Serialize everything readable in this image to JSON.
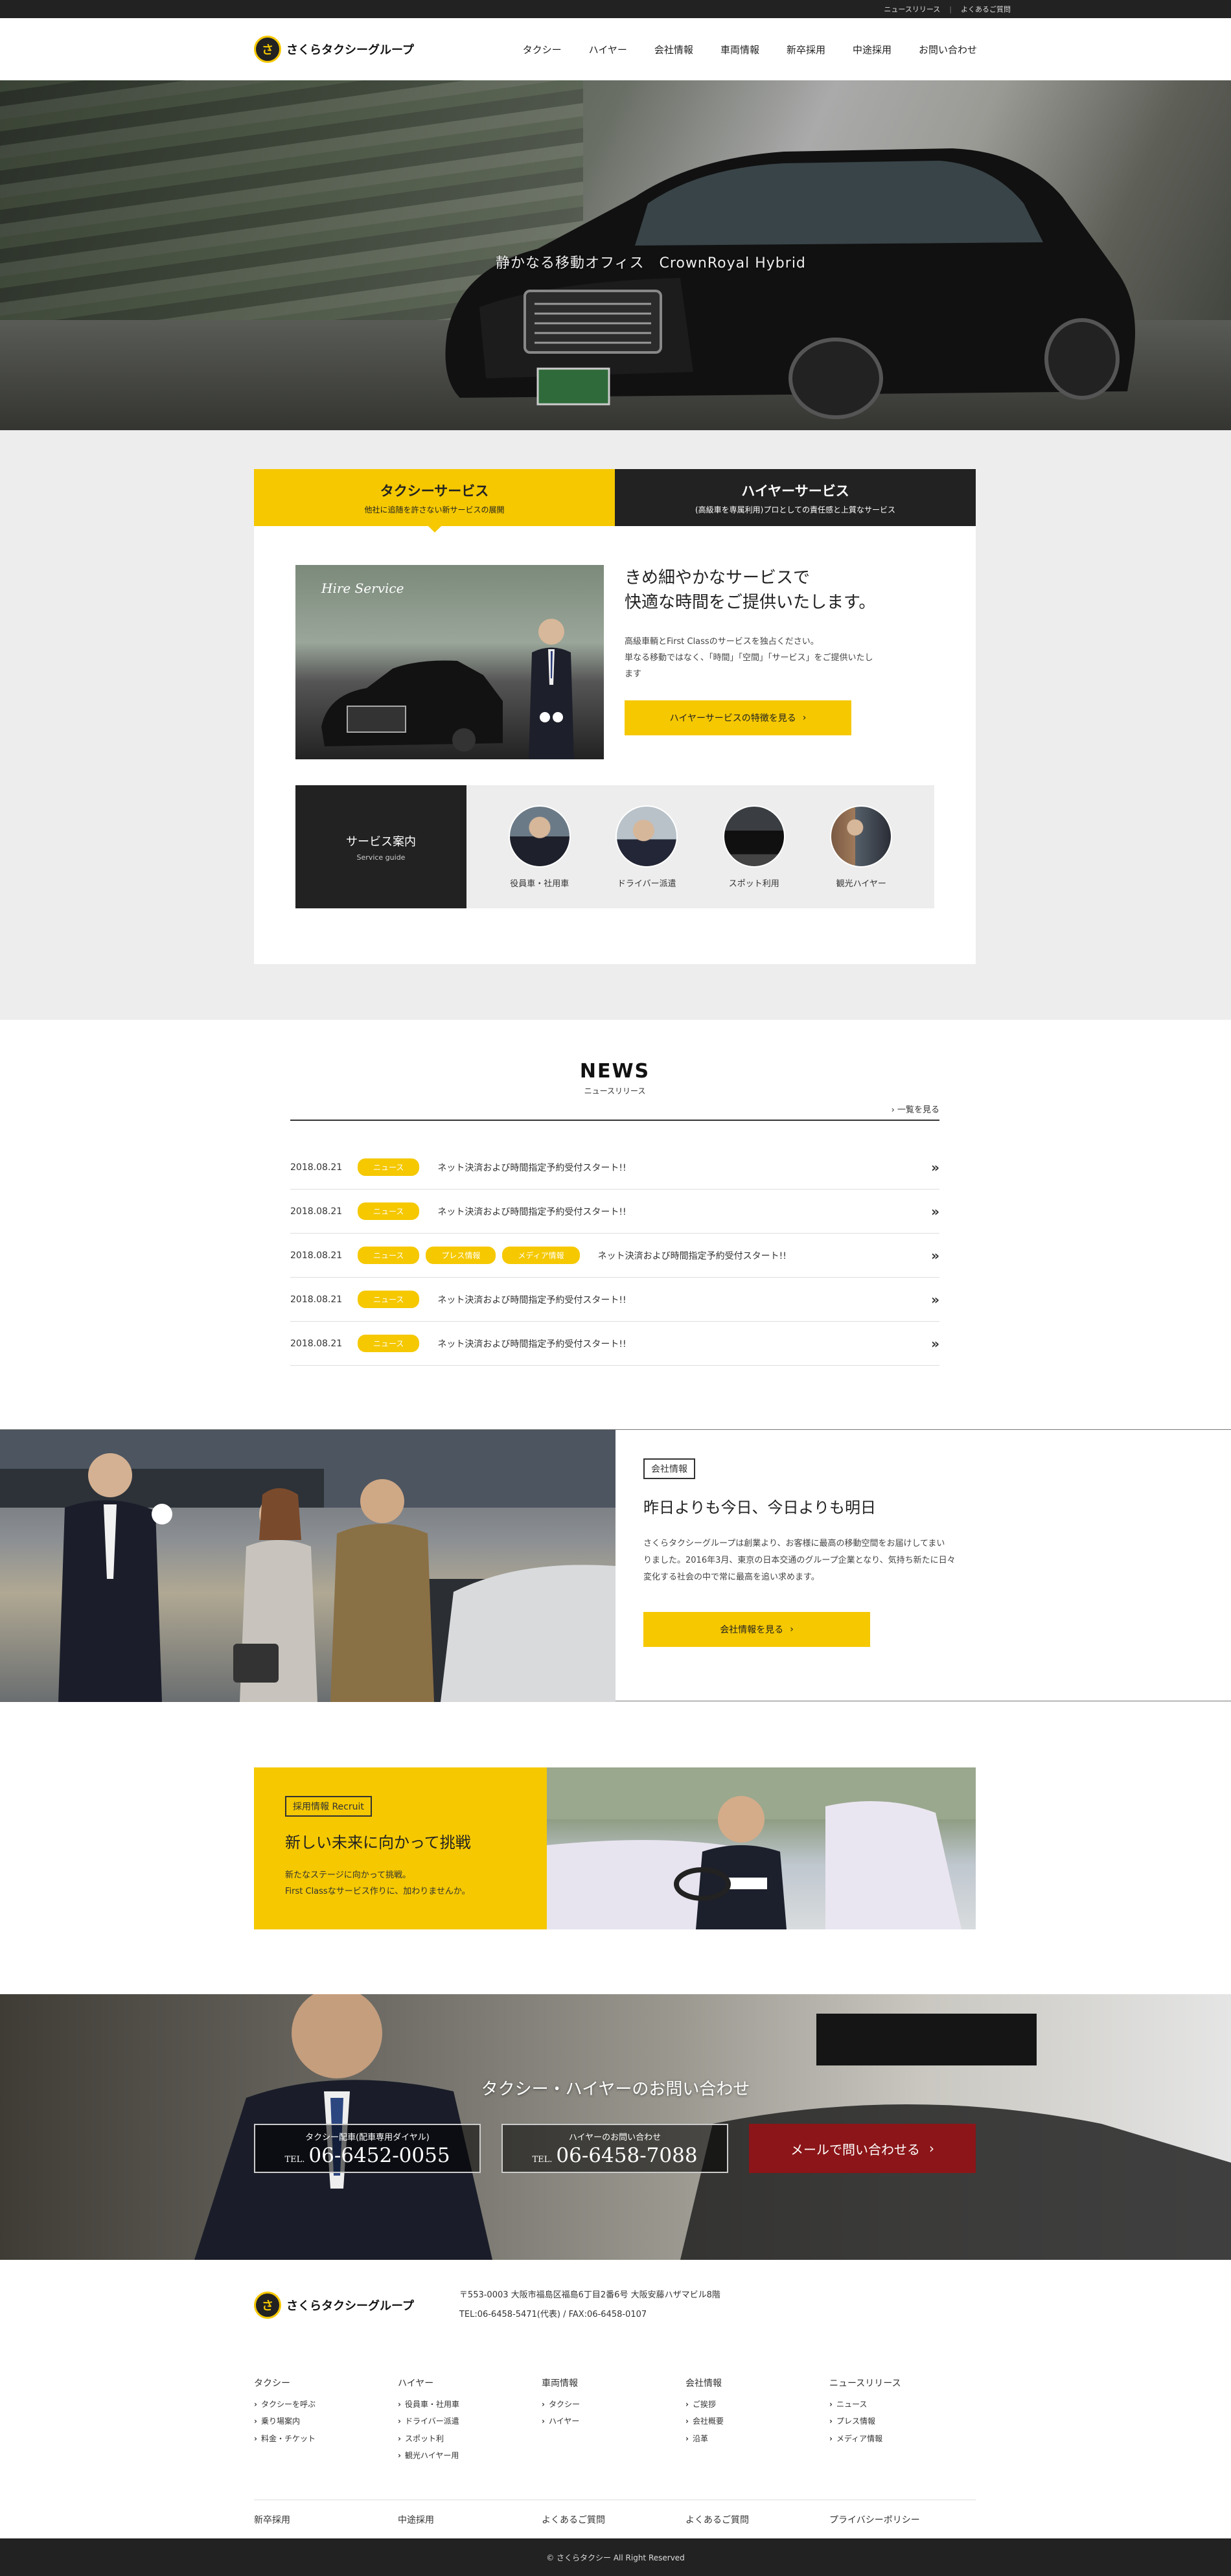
{
  "topbar": {
    "links": [
      "ニュースリリース",
      "よくあるご質問"
    ]
  },
  "header": {
    "logo_text": "さくらタクシーグループ",
    "nav": [
      "タクシー",
      "ハイヤー",
      "会社情報",
      "車両情報",
      "新卒採用",
      "中途採用",
      "お問い合わせ"
    ]
  },
  "hero": {
    "caption": "静かなる移動オフィス　CrownRoyal Hybrid"
  },
  "service": {
    "tabs": [
      {
        "title": "タクシーサービス",
        "sub": "他社に追随を許さない新サービスの展開"
      },
      {
        "title": "ハイヤーサービス",
        "sub": "(高級車を専属利用)プロとしての責任感と上質なサービス"
      }
    ],
    "image_script": "Hire Service",
    "heading_line1": "きめ細やかなサービスで",
    "heading_line2": "快適な時間をご提供いたします。",
    "body_line1": "高級車輌とFirst Classのサービスを独占ください。",
    "body_line2": "単なる移動ではなく、「時間」「空間」「サービス」をご提供いたし",
    "body_line3": "ます",
    "button": "ハイヤーサービスの特徴を見る",
    "guide": {
      "title": "サービス案内",
      "sub": "Service guide",
      "items": [
        "役員車・社用車",
        "ドライバー派遣",
        "スポット利用",
        "観光ハイヤー"
      ]
    }
  },
  "news": {
    "title": "NEWS",
    "sub": "ニュースリリース",
    "more": "一覧を見る",
    "items": [
      {
        "date": "2018.08.21",
        "tags": [
          "ニュース"
        ],
        "title": "ネット決済および時間指定予約受付スタート!!"
      },
      {
        "date": "2018.08.21",
        "tags": [
          "ニュース"
        ],
        "title": "ネット決済および時間指定予約受付スタート!!"
      },
      {
        "date": "2018.08.21",
        "tags": [
          "ニュース",
          "プレス情報",
          "メディア情報"
        ],
        "title": "ネット決済および時間指定予約受付スタート!!"
      },
      {
        "date": "2018.08.21",
        "tags": [
          "ニュース"
        ],
        "title": "ネット決済および時間指定予約受付スタート!!"
      },
      {
        "date": "2018.08.21",
        "tags": [
          "ニュース"
        ],
        "title": "ネット決済および時間指定予約受付スタート!!"
      }
    ]
  },
  "company": {
    "badge": "会社情報",
    "heading": "昨日よりも今日、今日よりも明日",
    "body_line1": "さくらタクシーグループは創業より、お客様に最高の移動空間をお届けしてまい",
    "body_line2": "りました。2016年3月、東京の日本交通のグループ企業となり、気持ち新たに日々",
    "body_line3": "変化する社会の中で常に最高を追い求めます。",
    "button": "会社情報を見る"
  },
  "recruit": {
    "badge": "採用情報 Recruit",
    "heading": "新しい未来に向かって挑戦",
    "body_line1": "新たなステージに向かって挑戦。",
    "body_line2": "First Classなサービス作りに、加わりませんか。"
  },
  "contact": {
    "heading": "タクシー・ハイヤーのお問い合わせ",
    "taxi_label": "タクシー配車(配車専用ダイヤル)",
    "taxi_tel_prefix": "TEL.",
    "taxi_tel": "06-6452-0055",
    "hire_label": "ハイヤーのお問い合わせ",
    "hire_tel_prefix": "TEL.",
    "hire_tel": "06-6458-7088",
    "mail_button": "メールで問い合わせる"
  },
  "footer": {
    "logo_text": "さくらタクシーグループ",
    "address": "〒553-0003 大阪市福島区福島6丁目2番6号 大阪安藤ハザマビル8階",
    "tel": "TEL:06-6458-5471(代表) / FAX:06-6458-0107",
    "columns": [
      {
        "title": "タクシー",
        "items": [
          "タクシーを呼ぶ",
          "乗り場案内",
          "料金・チケット"
        ]
      },
      {
        "title": "ハイヤー",
        "items": [
          "役員車・社用車",
          "ドライバー派遣",
          "スポット利",
          "観光ハイヤー用"
        ]
      },
      {
        "title": "車両情報",
        "items": [
          "タクシー",
          "ハイヤー"
        ]
      },
      {
        "title": "会社情報",
        "items": [
          "ご挨拶",
          "会社概要",
          "沿革"
        ]
      },
      {
        "title": "ニュースリリース",
        "items": [
          "ニュース",
          "プレス情報",
          "メディア情報"
        ]
      }
    ],
    "links": [
      "新卒採用",
      "中途採用",
      "よくあるご質問",
      "よくあるご質問",
      "プライバシーポリシー"
    ],
    "copyright": "© さくらタクシー All Right Reserved"
  },
  "colors": {
    "accent": "#f5c800",
    "dark": "#222222",
    "contact_red": "#8b1518"
  }
}
